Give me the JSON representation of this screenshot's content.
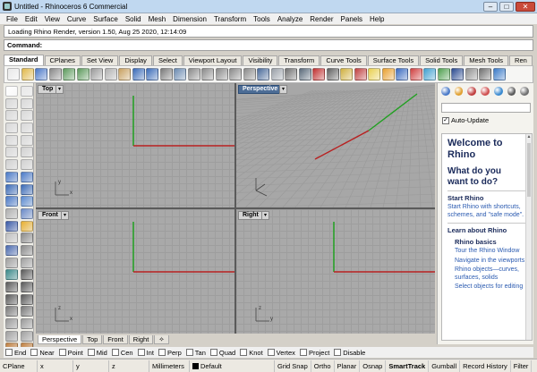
{
  "window": {
    "title": "Untitled - Rhinoceros 6 Commercial",
    "buttons": [
      "–",
      "□",
      "✕"
    ]
  },
  "menu": [
    "File",
    "Edit",
    "View",
    "Curve",
    "Surface",
    "Solid",
    "Mesh",
    "Dimension",
    "Transform",
    "Tools",
    "Analyze",
    "Render",
    "Panels",
    "Help"
  ],
  "command_history": "Loading Rhino Render, version 1.50, Aug 25 2020, 12:14:09",
  "command": {
    "label": "Command:",
    "value": ""
  },
  "toolbar_tabs": [
    "Standard",
    "CPlanes",
    "Set View",
    "Display",
    "Select",
    "Viewport Layout",
    "Visibility",
    "Transform",
    "Curve Tools",
    "Surface Tools",
    "Solid Tools",
    "Mesh Tools",
    "Ren"
  ],
  "toolbar_icons": [
    {
      "name": "new-icon",
      "color": "#e8e8e8"
    },
    {
      "name": "open-icon",
      "color": "#e0b84a"
    },
    {
      "name": "save-icon",
      "color": "#4a78c8"
    },
    {
      "name": "print-icon",
      "color": "#888888"
    },
    {
      "name": "import-icon",
      "color": "#5c9a5c"
    },
    {
      "name": "export-icon",
      "color": "#5c9a5c"
    },
    {
      "name": "cut-icon",
      "color": "#9a9a9a"
    },
    {
      "name": "copy-icon",
      "color": "#b0b0b0"
    },
    {
      "name": "paste-icon",
      "color": "#c8a060"
    },
    {
      "name": "undo-icon",
      "color": "#3a6ab8"
    },
    {
      "name": "redo-icon",
      "color": "#3a6ab8"
    },
    {
      "name": "pan-icon",
      "color": "#7a7a7a"
    },
    {
      "name": "rotate-view-icon",
      "color": "#6a8ab0"
    },
    {
      "name": "zoom-icon",
      "color": "#8a8a8a"
    },
    {
      "name": "zoom-window-icon",
      "color": "#8a8a8a"
    },
    {
      "name": "zoom-extents-icon",
      "color": "#8a8a8a"
    },
    {
      "name": "zoom-selected-icon",
      "color": "#8a8a8a"
    },
    {
      "name": "undo-view-icon",
      "color": "#8a8a8a"
    },
    {
      "name": "four-viewports-icon",
      "color": "#4a6a9a"
    },
    {
      "name": "grid-icon",
      "color": "#9aa0a8"
    },
    {
      "name": "wireframe-icon",
      "color": "#707070"
    },
    {
      "name": "shaded-icon",
      "color": "#5a6a7a"
    },
    {
      "name": "car-icon",
      "color": "#c03030"
    },
    {
      "name": "select-icon",
      "color": "#606060"
    },
    {
      "name": "layer-icon",
      "color": "#d0b040"
    },
    {
      "name": "properties-icon",
      "color": "#c04040"
    },
    {
      "name": "light-icon",
      "color": "#e8d050"
    },
    {
      "name": "sun-icon",
      "color": "#e8a030"
    },
    {
      "name": "render-sphere-icon",
      "color": "#3a6ac0"
    },
    {
      "name": "material-icon",
      "color": "#d04040"
    },
    {
      "name": "environment-icon",
      "color": "#40a0d0"
    },
    {
      "name": "ground-plane-icon",
      "color": "#50a050"
    },
    {
      "name": "render-icon",
      "color": "#2a4a90"
    },
    {
      "name": "teapot-icon",
      "color": "#909090"
    },
    {
      "name": "options-icon",
      "color": "#707070"
    },
    {
      "name": "help-icon",
      "color": "#3a7ac8"
    }
  ],
  "left_tools": [
    {
      "name": "select-arrow-icon",
      "color": "#ffffff"
    },
    {
      "name": "point-icon",
      "color": "#e8e8e8"
    },
    {
      "name": "polyline-icon",
      "color": "#d8d8d8"
    },
    {
      "name": "line-icon",
      "color": "#d8d8d8"
    },
    {
      "name": "curve-icon",
      "color": "#d8d8d8"
    },
    {
      "name": "freeform-curve-icon",
      "color": "#d8d8d8"
    },
    {
      "name": "circle-icon",
      "color": "#d8d8d8"
    },
    {
      "name": "arc-icon",
      "color": "#d8d8d8"
    },
    {
      "name": "ellipse-icon",
      "color": "#d8d8d8"
    },
    {
      "name": "rectangle-icon",
      "color": "#d8d8d8"
    },
    {
      "name": "polygon-icon",
      "color": "#d8d8d8"
    },
    {
      "name": "curve-tools-icon",
      "color": "#d0d0d0"
    },
    {
      "name": "fillet-icon",
      "color": "#d0d0d0"
    },
    {
      "name": "offset-icon",
      "color": "#d0d0d0"
    },
    {
      "name": "surface-from-points-icon",
      "color": "#4a7ac8"
    },
    {
      "name": "extrude-curve-icon",
      "color": "#4a7ac8"
    },
    {
      "name": "box-icon",
      "color": "#3a6ab8"
    },
    {
      "name": "sphere-icon",
      "color": "#3a6ab8"
    },
    {
      "name": "extrude-surface-icon",
      "color": "#4a7ac8"
    },
    {
      "name": "loft-icon",
      "color": "#5a8ad0"
    },
    {
      "name": "mesh-icon",
      "color": "#b0b0b0"
    },
    {
      "name": "surface-tools-icon",
      "color": "#6a8ac8"
    },
    {
      "name": "solid-tools-icon",
      "color": "#3a5aa8"
    },
    {
      "name": "explode-icon",
      "color": "#e8b030"
    },
    {
      "name": "join-icon",
      "color": "#c0c0c0"
    },
    {
      "name": "trim-icon",
      "color": "#8a8a8a"
    },
    {
      "name": "boolean-union-icon",
      "color": "#4a6ab0"
    },
    {
      "name": "split-icon",
      "color": "#8a8a8a"
    },
    {
      "name": "group-icon",
      "color": "#a0a0a0"
    },
    {
      "name": "ungroup-icon",
      "color": "#a0a0a0"
    },
    {
      "name": "transform-icon",
      "color": "#3a8a8a"
    },
    {
      "name": "move-icon",
      "color": "#5a5a5a"
    },
    {
      "name": "copy-object-icon",
      "color": "#5a5a5a"
    },
    {
      "name": "rotate-icon",
      "color": "#5a5a5a"
    },
    {
      "name": "scale-icon",
      "color": "#5a5a5a"
    },
    {
      "name": "mirror-icon",
      "color": "#5a5a5a"
    },
    {
      "name": "array-icon",
      "color": "#7a7a7a"
    },
    {
      "name": "orient-icon",
      "color": "#7a7a7a"
    },
    {
      "name": "dimension-icon",
      "color": "#9a9a9a"
    },
    {
      "name": "text-icon",
      "color": "#9a9a9a"
    },
    {
      "name": "hatch-icon",
      "color": "#a0a0a0"
    },
    {
      "name": "leader-icon",
      "color": "#a0a0a0"
    },
    {
      "name": "analyze-icon",
      "color": "#c08040"
    },
    {
      "name": "curvature-icon",
      "color": "#c08040"
    }
  ],
  "viewports": [
    {
      "id": "top",
      "label": "Top",
      "active": false
    },
    {
      "id": "perspective",
      "label": "Perspective",
      "active": true
    },
    {
      "id": "front",
      "label": "Front",
      "active": false
    },
    {
      "id": "right",
      "label": "Right",
      "active": false
    }
  ],
  "axis_letters": {
    "x": "x",
    "y": "y",
    "z": "z"
  },
  "axis_colors": {
    "x": "#b82020",
    "y": "#20a020"
  },
  "viewport_tabs": [
    "Perspective",
    "Top",
    "Front",
    "Right",
    "✧"
  ],
  "osnaps": [
    "End",
    "Near",
    "Point",
    "Mid",
    "Cen",
    "Int",
    "Perp",
    "Tan",
    "Quad",
    "Knot",
    "Vertex",
    "Project",
    "Disable"
  ],
  "status": {
    "cplane": "CPlane",
    "x": "x",
    "y": "y",
    "z": "z",
    "units": "Millimeters",
    "layer": "Default",
    "toggles": [
      "Grid Snap",
      "Ortho",
      "Planar",
      "Osnap",
      "SmartTrack",
      "Gumball",
      "Record History",
      "Filter"
    ],
    "bold_toggle": "SmartTrack"
  },
  "panel": {
    "tab_icons": [
      {
        "name": "properties-tab-icon",
        "color": "#4a7ac8"
      },
      {
        "name": "layers-tab-icon",
        "color": "#e0a030"
      },
      {
        "name": "render-tab-icon",
        "color": "#c04040"
      },
      {
        "name": "materials-tab-icon",
        "color": "#d05050"
      },
      {
        "name": "environment-tab-icon",
        "color": "#3a8ad0"
      },
      {
        "name": "help-tab-icon",
        "color": "#5a5a5a"
      },
      {
        "name": "more-tab-icon",
        "color": "#707070"
      }
    ],
    "search_placeholder": "",
    "auto_update": "Auto-Update",
    "welcome_title": "Welcome to Rhino",
    "what_to_do": "What do you want to do?",
    "start_heading": "Start Rhino",
    "start_link": "Start Rhino with shortcuts, schemes, and \"safe mode\".",
    "learn_heading": "Learn about Rhino",
    "basics_heading": "Rhino basics",
    "links": [
      "Tour the Rhino Window",
      "Navigate in the viewports",
      "Rhino objects—curves, surfaces, solids",
      "Select objects for editing"
    ]
  }
}
